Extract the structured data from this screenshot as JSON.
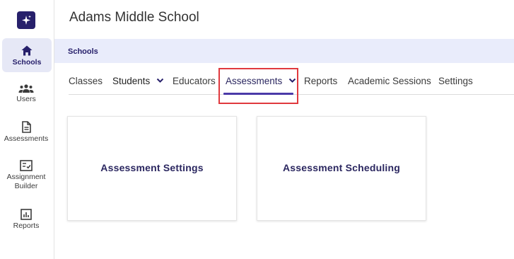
{
  "app": {
    "school_name": "Adams Middle School"
  },
  "sidebar": {
    "items": [
      {
        "label": "Schools",
        "icon": "home-icon",
        "active": true
      },
      {
        "label": "Users",
        "icon": "users-icon"
      },
      {
        "label": "Assessments",
        "icon": "document-icon"
      },
      {
        "label": "Assignment Builder",
        "icon": "checklist-icon"
      },
      {
        "label": "Reports",
        "icon": "bar-chart-icon"
      }
    ]
  },
  "breadcrumb": {
    "current": "Schools"
  },
  "tabs": [
    {
      "label": "Classes"
    },
    {
      "label": "Students",
      "has_dropdown": true
    },
    {
      "label": "Educators"
    },
    {
      "label": "Assessments",
      "has_dropdown": true,
      "selected": true
    },
    {
      "label": "Reports"
    },
    {
      "label": "Academic Sessions"
    },
    {
      "label": "Settings"
    }
  ],
  "cards": [
    {
      "title": "Assessment Settings"
    },
    {
      "title": "Assessment Scheduling"
    }
  ],
  "colors": {
    "brand": "#27206b",
    "accent": "#4b3aa8",
    "highlight": "#e0393e",
    "breadcrumb_bg": "#e9ecfb"
  }
}
